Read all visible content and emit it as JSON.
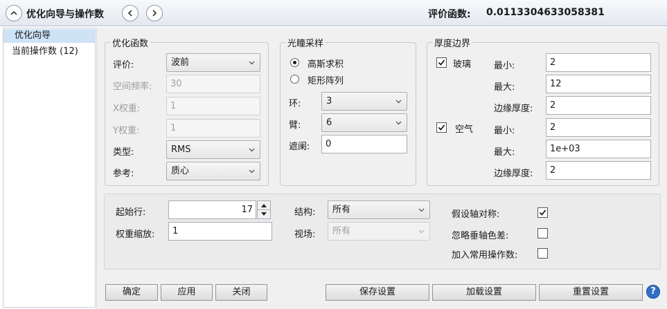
{
  "titlebar": {
    "title": "优化向导与操作数",
    "merit_label": "评价函数:",
    "merit_value": "0.0113304633058381"
  },
  "sidebar": {
    "items": [
      {
        "label": "优化向导",
        "selected": true
      },
      {
        "label": "当前操作数 (12)",
        "selected": false
      }
    ]
  },
  "optimization_function": {
    "legend": "优化函数",
    "criterion_label": "评价:",
    "criterion_value": "波前",
    "spatial_freq_label": "空间频率:",
    "spatial_freq_value": "30",
    "x_weight_label": "X权重:",
    "x_weight_value": "1",
    "y_weight_label": "Y权重:",
    "y_weight_value": "1",
    "type_label": "类型:",
    "type_value": "RMS",
    "reference_label": "参考:",
    "reference_value": "质心"
  },
  "pupil_sampling": {
    "legend": "光瞳采样",
    "option_gaussian": "高斯求积",
    "option_rect": "矩形阵列",
    "selected": "高斯求积",
    "rings_label": "环:",
    "rings_value": "3",
    "arms_label": "臂:",
    "arms_value": "6",
    "obscuration_label": "遮阑:",
    "obscuration_value": "0"
  },
  "thickness_boundary": {
    "legend": "厚度边界",
    "glass_label": "玻璃",
    "glass_checked": true,
    "glass_min_label": "最小:",
    "glass_min_value": "2",
    "glass_max_label": "最大:",
    "glass_max_value": "12",
    "glass_edge_label": "边缘厚度:",
    "glass_edge_value": "2",
    "air_label": "空气",
    "air_checked": true,
    "air_min_label": "最小:",
    "air_min_value": "2",
    "air_max_label": "最大:",
    "air_max_value": "1e+03",
    "air_edge_label": "边缘厚度:",
    "air_edge_value": "2"
  },
  "bottom_options": {
    "start_row_label": "起始行:",
    "start_row_value": "17",
    "weight_scale_label": "权重缩放:",
    "weight_scale_value": "1",
    "structure_label": "结构:",
    "structure_value": "所有",
    "field_label": "视场:",
    "field_value": "所有",
    "assume_axial_symmetry_label": "假设轴对称:",
    "assume_axial_symmetry_checked": true,
    "ignore_lateral_color_label": "忽略垂轴色差:",
    "ignore_lateral_color_checked": false,
    "add_favorite_operands_label": "加入常用操作数:",
    "add_favorite_operands_checked": false
  },
  "buttons": {
    "ok": "确定",
    "apply": "应用",
    "close": "关闭",
    "save_settings": "保存设置",
    "load_settings": "加载设置",
    "reset_settings": "重置设置"
  },
  "icons": {
    "collapse": "chevron-up-icon",
    "prev": "chevron-left-icon",
    "next": "chevron-right-icon",
    "help": "help-icon"
  },
  "colors": {
    "selection": "#cfe3f7",
    "panel_bg": "#f0f0f0",
    "help_blue": "#2f6fc8"
  }
}
